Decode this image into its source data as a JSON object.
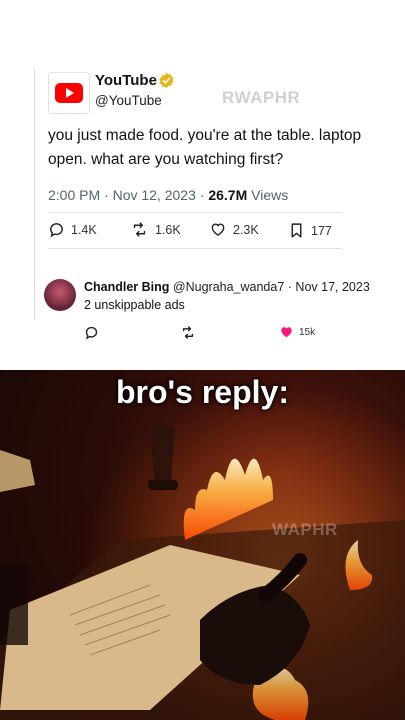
{
  "tweet": {
    "account_name": "YouTube",
    "account_handle": "@YouTube",
    "text": "you just made food. you're at the table. laptop open. what are you watching first?",
    "time": "2:00 PM",
    "date": "Nov 12, 2023",
    "views_count": "26.7M",
    "views_label": "Views",
    "replies": "1.4K",
    "retweets": "1.6K",
    "likes": "2.3K",
    "bookmarks": "177"
  },
  "reply": {
    "name": "Chandler Bing",
    "handle": "@Nugraha_wanda7",
    "date": "Nov 17, 2023",
    "text": "2 unskippable ads",
    "likes": "15k"
  },
  "watermark": "RWAPHR",
  "watermark_bottom": "WAPHR",
  "video": {
    "caption": "bro's reply:"
  },
  "colors": {
    "youtube_red": "#ff0000",
    "verified_gold": "#e2b719",
    "like_pink": "#f91880"
  }
}
